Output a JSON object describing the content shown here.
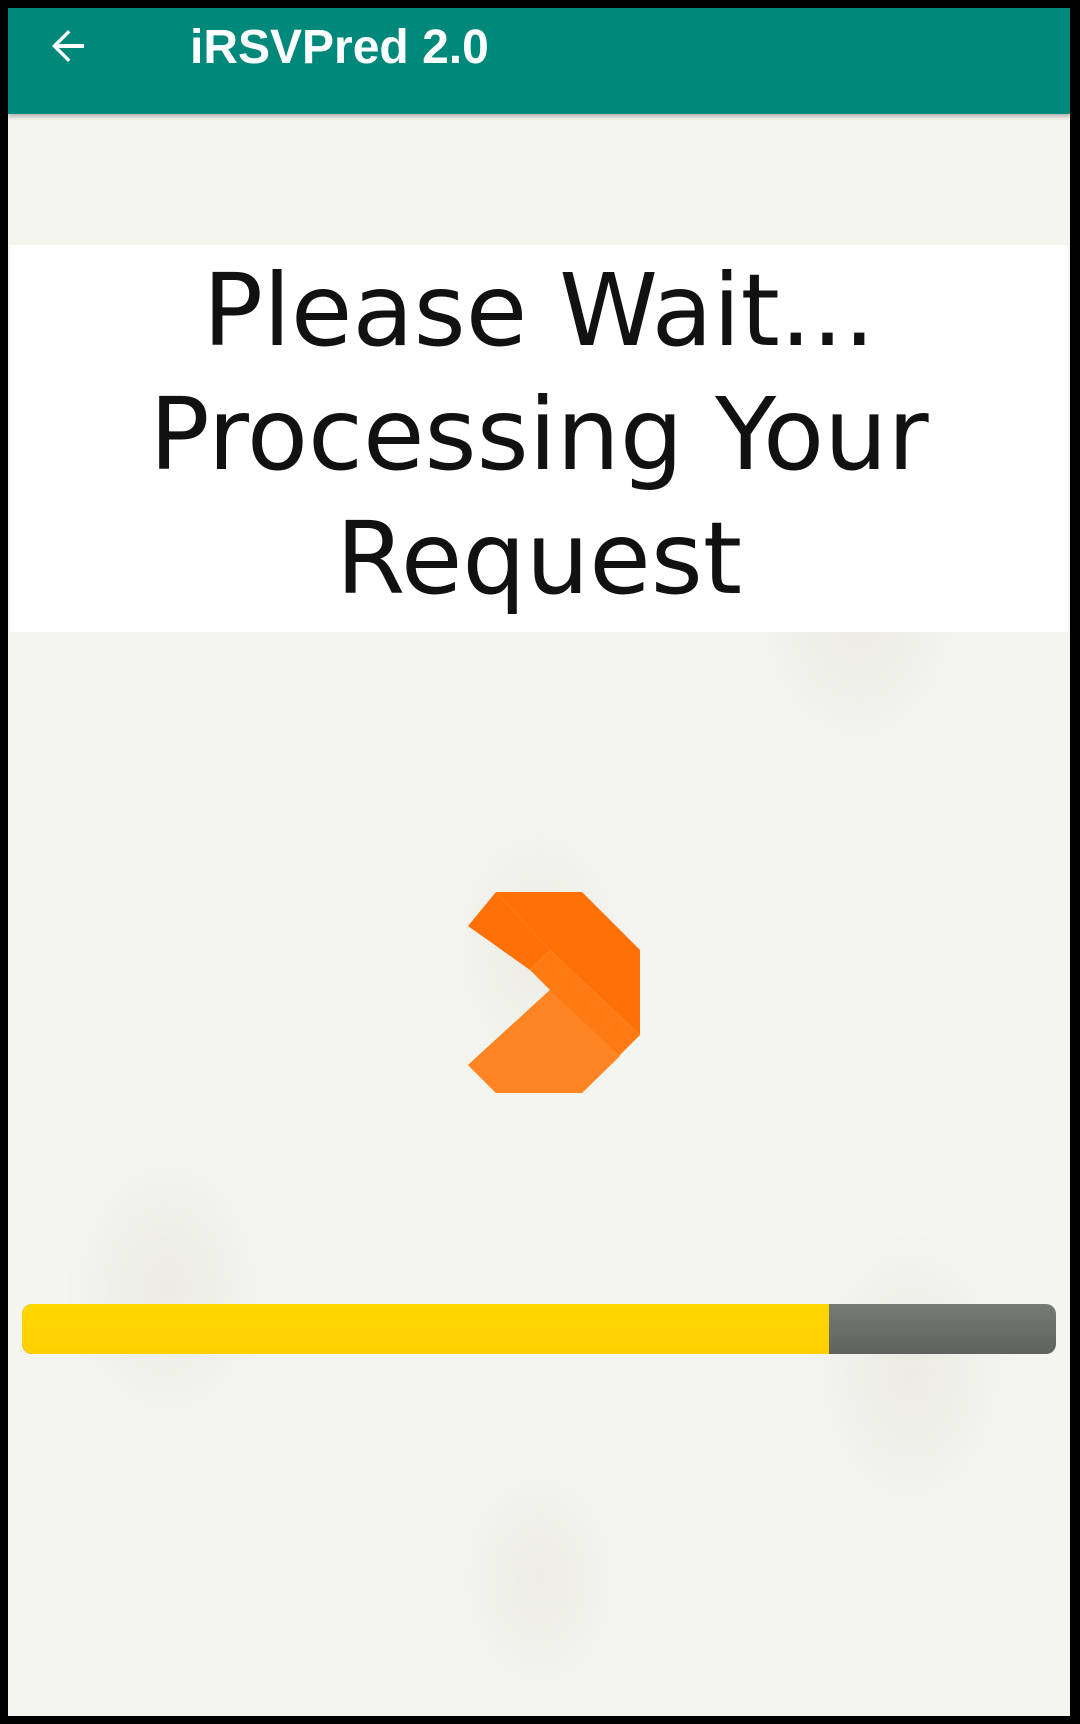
{
  "appbar": {
    "title": "iRSVPred 2.0",
    "back_icon": "arrow-left-icon",
    "color": "#00897b"
  },
  "message": {
    "lines": [
      "Please Wait...",
      "Processing Your",
      "Request"
    ]
  },
  "loader": {
    "icon": "loading-chevron-icon",
    "color": "#ff7006"
  },
  "progress": {
    "value_percent": 78,
    "fill_color": "#ffd000",
    "track_color": "#6b6e6a"
  }
}
